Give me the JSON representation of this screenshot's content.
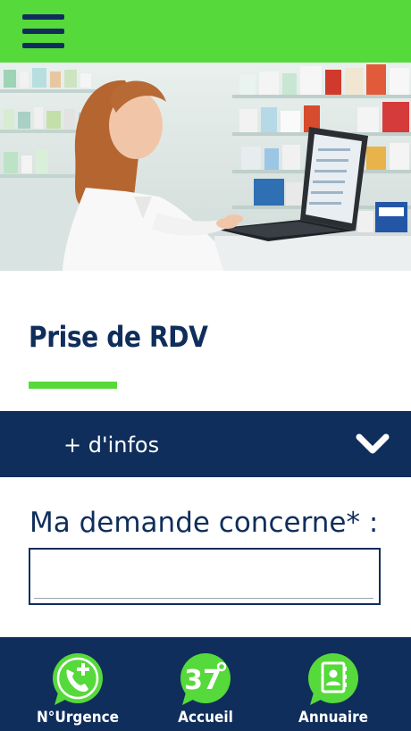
{
  "header": {
    "menu_icon": "hamburger-menu-icon",
    "accent": "#56d93a",
    "primary": "#0f2e5b"
  },
  "hero": {
    "image_alt": "pharmacist-at-laptop"
  },
  "page": {
    "title": "Prise de RDV"
  },
  "infos": {
    "label": "+ d'infos",
    "icon": "chevron-down-icon"
  },
  "form": {
    "request_label": "Ma demande concerne* :",
    "request_value": ""
  },
  "bottom_nav": {
    "items": [
      {
        "label": "N°Urgence",
        "icon": "emergency-phone-icon"
      },
      {
        "label": "Accueil",
        "icon": "home-37-icon"
      },
      {
        "label": "Annuaire",
        "icon": "contacts-book-icon"
      }
    ]
  }
}
